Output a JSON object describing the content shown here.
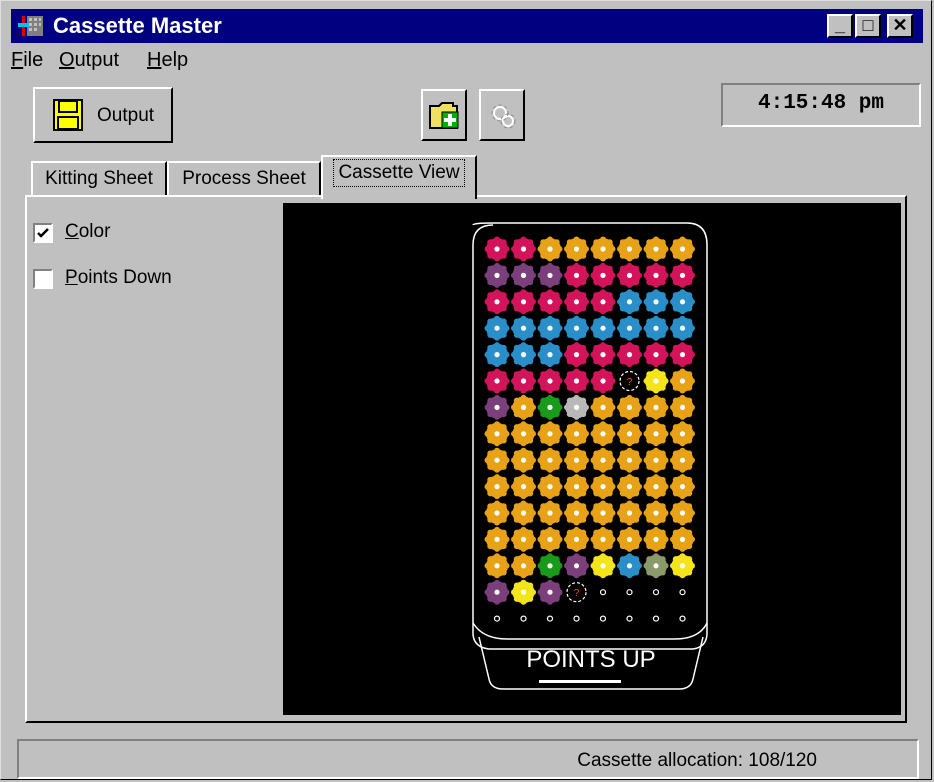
{
  "window": {
    "title": "Cassette Master"
  },
  "titlebar_buttons": {
    "minimize": "_",
    "maximize": "□",
    "close": "✕"
  },
  "menu": [
    {
      "label": "File",
      "mnemonic": "F",
      "rest": "ile"
    },
    {
      "label": "Output",
      "mnemonic": "O",
      "rest": "utput"
    },
    {
      "label": "Help",
      "mnemonic": "H",
      "rest": "elp"
    }
  ],
  "toolbar": {
    "output_label": "Output",
    "output_icon": "floppy-disk-icon",
    "new_folder_icon": "new-folder-icon",
    "settings_icon": "gear-icon"
  },
  "clock": {
    "time": "4:15:48 pm"
  },
  "tabs": [
    {
      "label": "Kitting Sheet",
      "active": false
    },
    {
      "label": "Process Sheet",
      "active": false
    },
    {
      "label": "Cassette View",
      "active": true
    }
  ],
  "options": {
    "color": {
      "mnemonic": "C",
      "rest": "olor",
      "checked": true
    },
    "points_down": {
      "mnemonic": "P",
      "rest": "oints Down",
      "checked": false
    }
  },
  "cassette": {
    "base_label": "POINTS UP",
    "palette": {
      "R": "#d4145a",
      "O": "#e8a217",
      "P": "#7b3f7b",
      "B": "#2a8fc8",
      "G": "#1a9a1a",
      "S": "#b8b8b8",
      "Y": "#f4e41c",
      "K": "#8a9a6a",
      "U": "unknown",
      "E": "empty"
    },
    "rows": [
      "RROOOOOO",
      "PPPRRRRR",
      "RRRRRBBB",
      "BBBBBBBB",
      "BBBRRRRR",
      "RRRRRUYO",
      "POGSOOOO",
      "OOOOOOOO",
      "OOOOOOOO",
      "OOOOOOOO",
      "OOOOOOOO",
      "OOOOOOOO",
      "OOGPYBKY",
      "PYPUEEEE",
      "EEEEEEEE"
    ]
  },
  "status": {
    "text": "Cassette allocation: 108/120"
  }
}
